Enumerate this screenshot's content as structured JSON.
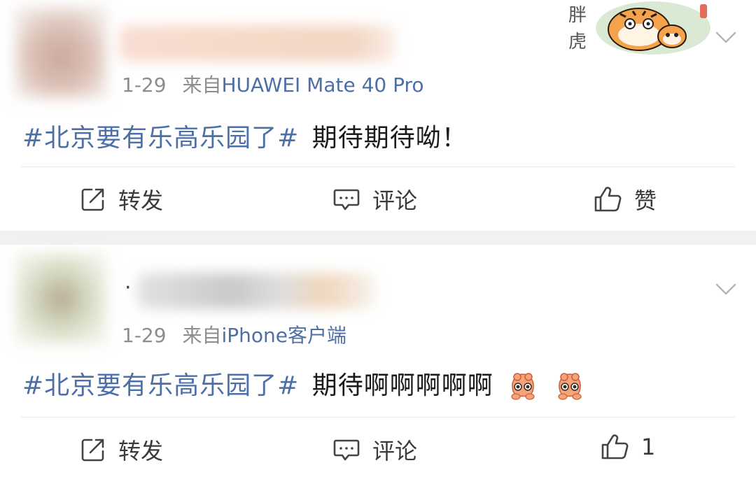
{
  "posts": [
    {
      "date": "1-29",
      "source_prefix": "来自",
      "device": "HUAWEI Mate 40 Pro",
      "hashtag": "#北京要有乐高乐园了#",
      "text": "期待期待呦！",
      "has_sticker": true,
      "sticker_text_top": "胖",
      "sticker_text_bottom": "虎",
      "actions": {
        "repost": "转发",
        "comment": "评论",
        "like": "赞"
      }
    },
    {
      "name_prefix": "·",
      "date": "1-29",
      "source_prefix": "来自",
      "device": "iPhone客户端",
      "hashtag": "#北京要有乐高乐园了#",
      "text": "期待啊啊啊啊啊",
      "emojis": [
        "shy-bear-emoji",
        "shy-bear-emoji"
      ],
      "actions": {
        "repost": "转发",
        "comment": "评论",
        "like": "1"
      }
    }
  ],
  "colors": {
    "link_blue": "#4b6fa8",
    "meta_gray": "#8d8d8d",
    "separator": "#f1f1f1"
  }
}
